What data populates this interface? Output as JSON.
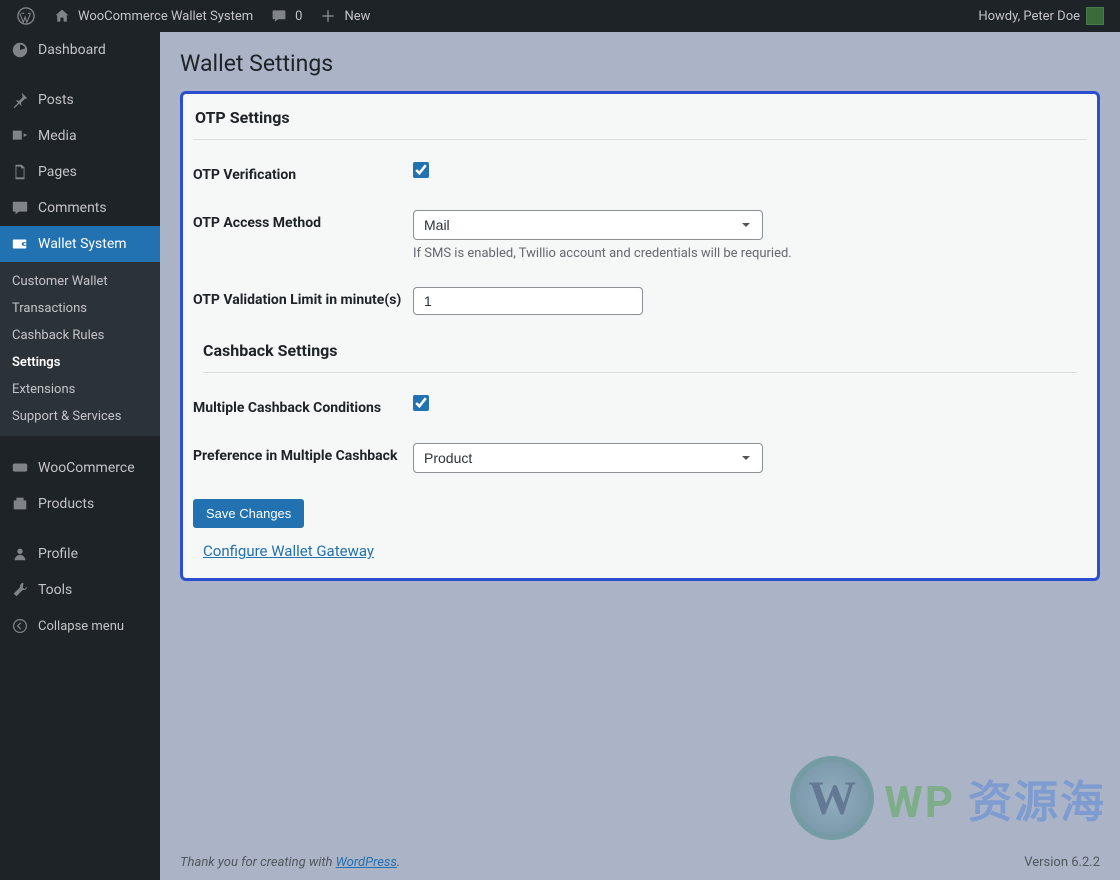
{
  "adminbar": {
    "site_name": "WooCommerce Wallet System",
    "comments_count": "0",
    "new_label": "New",
    "howdy": "Howdy, Peter Doe"
  },
  "sidebar": {
    "dashboard": "Dashboard",
    "posts": "Posts",
    "media": "Media",
    "pages": "Pages",
    "comments": "Comments",
    "wallet_system": "Wallet System",
    "submenu": {
      "customer_wallet": "Customer Wallet",
      "transactions": "Transactions",
      "cashback_rules": "Cashback Rules",
      "settings": "Settings",
      "extensions": "Extensions",
      "support": "Support & Services"
    },
    "woocommerce": "WooCommerce",
    "products": "Products",
    "profile": "Profile",
    "tools": "Tools",
    "collapse": "Collapse menu"
  },
  "page": {
    "title": "Wallet Settings"
  },
  "otp": {
    "section_title": "OTP Settings",
    "verification_label": "OTP Verification",
    "verification_checked": true,
    "access_method_label": "OTP Access Method",
    "access_method_value": "Mail",
    "access_method_desc": "If SMS is enabled, Twillio account and credentials will be requried.",
    "validation_limit_label": "OTP Validation Limit in minute(s)",
    "validation_limit_value": "1"
  },
  "cashback": {
    "section_title": "Cashback Settings",
    "multiple_label": "Multiple Cashback Conditions",
    "multiple_checked": true,
    "preference_label": "Preference in Multiple Cashback",
    "preference_value": "Product"
  },
  "actions": {
    "save_label": "Save Changes",
    "configure_link": "Configure Wallet Gateway"
  },
  "footer": {
    "thanks_prefix": "Thank you for creating with ",
    "wp_link": "WordPress",
    "version": "Version 6.2.2"
  },
  "watermark": {
    "text1": "WP",
    "text2": "资源海"
  }
}
